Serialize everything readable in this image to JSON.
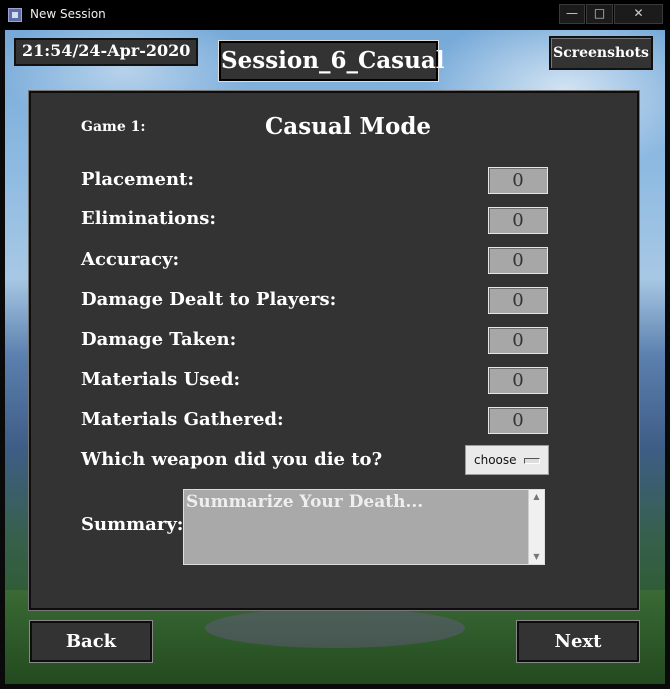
{
  "window": {
    "title": "New Session",
    "minimize": "—",
    "maximize": "□",
    "close": "✕"
  },
  "header": {
    "datetime": "21:54/24-Apr-2020",
    "session_name": "Session_6_Casual",
    "screenshots_label": "Screenshots"
  },
  "panel": {
    "game_label": "Game 1:",
    "mode_title": "Casual Mode",
    "stats": [
      {
        "label": "Placement:",
        "value": "0"
      },
      {
        "label": "Eliminations:",
        "value": "0"
      },
      {
        "label": "Accuracy:",
        "value": "0"
      },
      {
        "label": "Damage Dealt to Players:",
        "value": "0"
      },
      {
        "label": "Damage Taken:",
        "value": "0"
      },
      {
        "label": "Materials Used:",
        "value": "0"
      },
      {
        "label": "Materials Gathered:",
        "value": "0"
      }
    ],
    "weapon_label": "Which weapon did you die to?",
    "weapon_selected": "choose",
    "summary_label": "Summary:",
    "summary_placeholder": "Summarize Your Death..."
  },
  "nav": {
    "back_label": "Back",
    "next_label": "Next"
  }
}
